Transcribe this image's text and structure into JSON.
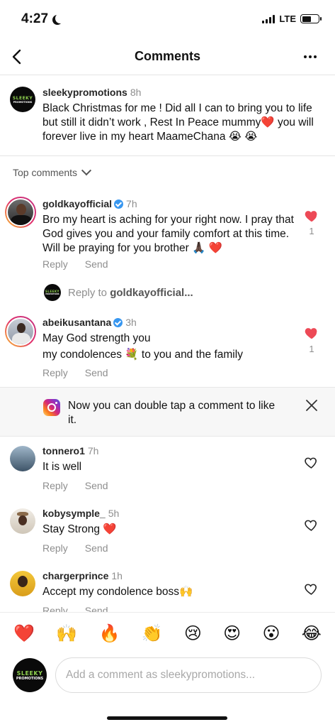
{
  "status_bar": {
    "time": "4:27",
    "network": "LTE",
    "battery_level": 0.55
  },
  "header": {
    "title": "Comments"
  },
  "caption": {
    "username": "sleekypromotions",
    "time": "8h",
    "text": "Black Christmas for me ! Did all I can to bring you to life but still it didn’t work , Rest In Peace mummy❤️ you will forever live in my heart MaameChana 😭 😭",
    "logo_line1": "SLEEKY",
    "logo_line2": "PROMOTIONS"
  },
  "top_comments_label": "Top comments",
  "comments": [
    {
      "username": "goldkayofficial",
      "time": "7h",
      "verified": true,
      "text": "Bro my heart is aching for your right now. I pray that God gives you and your family comfort at this time. Will be praying for you brother 🙏🏿 ❤️",
      "liked": true,
      "likes": "1",
      "reply": "Reply",
      "send": "Send"
    },
    {
      "username": "abeikusantana",
      "time": "3h",
      "verified": true,
      "text": "May God strength you\nmy condolences 💐  to you and the family",
      "liked": true,
      "likes": "1",
      "reply": "Reply",
      "send": "Send"
    },
    {
      "username": "tonnero1",
      "time": "7h",
      "verified": false,
      "text": "It is well",
      "liked": false,
      "reply": "Reply",
      "send": "Send"
    },
    {
      "username": "kobysymple_",
      "time": "5h",
      "verified": false,
      "text": "Stay Strong ❤️",
      "liked": false,
      "reply": "Reply",
      "send": "Send"
    },
    {
      "username": "chargerprince",
      "time": "1h",
      "verified": false,
      "text": "Accept my condolence boss🙌",
      "liked": false,
      "reply": "Reply",
      "send": "Send"
    }
  ],
  "reply_to": {
    "prefix": "Reply to",
    "username": "goldkayofficial..."
  },
  "tip": {
    "text": "Now you can double tap a comment to like it."
  },
  "emoji_bar": [
    "❤️",
    "🙌",
    "🔥",
    "👏",
    "😢",
    "😍",
    "😮",
    "😂"
  ],
  "composer": {
    "placeholder": "Add a comment as sleekypromotions..."
  },
  "colors": {
    "like_red": "#ed4956",
    "verified_blue": "#3897f0",
    "muted": "#8e8e8e"
  }
}
